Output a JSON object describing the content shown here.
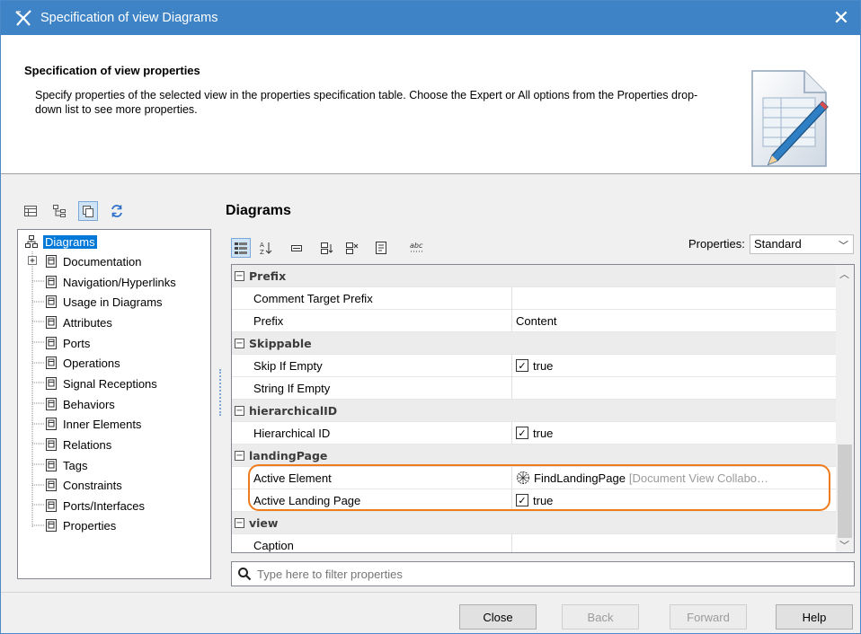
{
  "window": {
    "title": "Specification of view Diagrams",
    "close_glyph": "✕"
  },
  "header": {
    "title": "Specification of view properties",
    "description": "Specify properties of the selected view in the properties specification table. Choose the Expert or All options from the Properties drop-down list to see more properties."
  },
  "left_toolbar": {
    "icons": [
      "table-icon",
      "tree-icon",
      "copy-icon",
      "refresh-icon"
    ]
  },
  "tree": {
    "root": "Diagrams",
    "items": [
      "Documentation",
      "Navigation/Hyperlinks",
      "Usage in Diagrams",
      "Attributes",
      "Ports",
      "Operations",
      "Signal Receptions",
      "Behaviors",
      "Inner Elements",
      "Relations",
      "Tags",
      "Constraints",
      "Ports/Interfaces",
      "Properties"
    ]
  },
  "panel": {
    "title": "Diagrams",
    "properties_label": "Properties:",
    "properties_value": "Standard"
  },
  "grid": {
    "groups": {
      "prefix": "Prefix",
      "skippable": "Skippable",
      "hierarchical": "hierarchicalID",
      "landing": "landingPage",
      "view": "view"
    },
    "rows": {
      "comment_target_prefix": {
        "key": "Comment Target Prefix",
        "value": ""
      },
      "prefix": {
        "key": "Prefix",
        "value": "Content"
      },
      "skip_if_empty": {
        "key": "Skip If Empty",
        "value": "true"
      },
      "string_if_empty": {
        "key": "String If Empty",
        "value": ""
      },
      "hierarchical_id": {
        "key": "Hierarchical ID",
        "value": "true"
      },
      "active_element": {
        "key": "Active Element",
        "value": "FindLandingPage",
        "extra": "[Document View Collabo…"
      },
      "active_landing_page": {
        "key": "Active Landing Page",
        "value": "true"
      },
      "caption": {
        "key": "Caption",
        "value": ""
      }
    }
  },
  "filter": {
    "placeholder": "Type here to filter properties"
  },
  "buttons": {
    "close": "Close",
    "back": "Back",
    "forward": "Forward",
    "help": "Help"
  },
  "colors": {
    "titlebar": "#3d83c5",
    "highlight": "#f07b1d",
    "selection": "#0078d7"
  }
}
